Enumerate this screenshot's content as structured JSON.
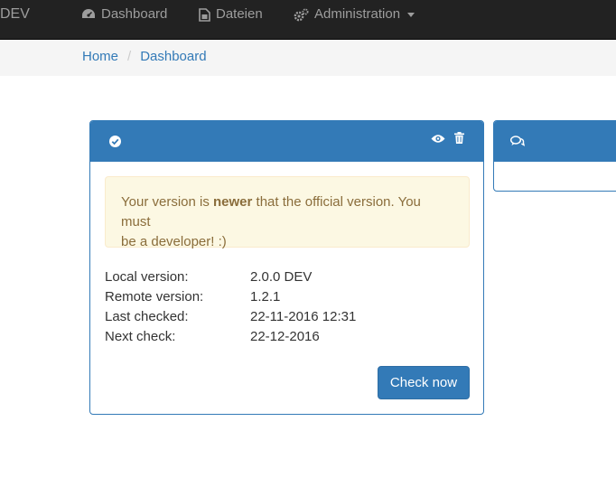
{
  "navbar": {
    "brand": "DEV",
    "items": [
      {
        "label": "Dashboard",
        "icon": "dashboard-icon"
      },
      {
        "label": "Dateien",
        "icon": "file-icon"
      },
      {
        "label": "Administration",
        "icon": "cogs-icon"
      }
    ]
  },
  "breadcrumb": {
    "items": [
      "Home",
      "Dashboard"
    ],
    "separator": "/"
  },
  "version_panel": {
    "header_icon": "check-circle-icon",
    "actions": [
      "eye-icon",
      "trash-icon"
    ],
    "alert": {
      "prefix": "Your version is ",
      "emphasis": "newer",
      "suffix_line1": " that the official version. You must",
      "line2": "be a developer! :)"
    },
    "info": [
      {
        "label": "Local version:",
        "value": "2.0.0 DEV"
      },
      {
        "label": "Remote version:",
        "value": "1.2.1"
      },
      {
        "label": "Last checked:",
        "value": "22-11-2016 12:31"
      },
      {
        "label": "Next check:",
        "value": "22-12-2016"
      }
    ],
    "button_label": "Check now"
  },
  "side_panel": {
    "header_icon": "comments-icon"
  },
  "colors": {
    "navbar_bg": "#222222",
    "primary": "#337ab7",
    "alert_bg": "#fcf8e3",
    "alert_text": "#8a6d3b"
  }
}
